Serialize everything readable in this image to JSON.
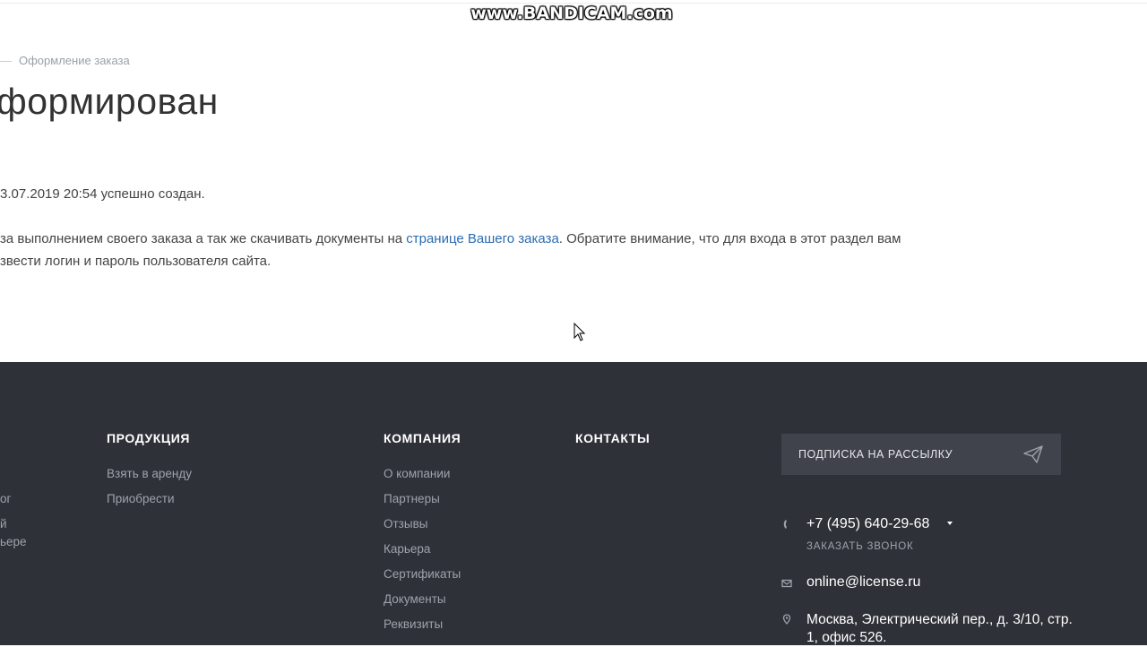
{
  "watermark": "www.BANDICAM.com",
  "breadcrumb": {
    "current": "Оформление заказа"
  },
  "page": {
    "title": "формирован",
    "line1": "3.07.2019 20:54 успешно создан.",
    "line2_before": "за выполнением своего заказа а так же скачивать документы на ",
    "line2_link": "странице Вашего заказа",
    "line2_after": ". Обратите внимание, что для входа в этот раздел вам",
    "line3": "звести логин и пароль пользователя сайта."
  },
  "footer": {
    "left_fragments": [
      "ог",
      "й",
      "ьере"
    ],
    "products": {
      "title": "ПРОДУКЦИЯ",
      "items": [
        "Взять в аренду",
        "Приобрести"
      ]
    },
    "company": {
      "title": "КОМПАНИЯ",
      "items": [
        "О компании",
        "Партнеры",
        "Отзывы",
        "Карьера",
        "Сертификаты",
        "Документы",
        "Реквизиты"
      ]
    },
    "contacts": {
      "title": "КОНТАКТЫ"
    },
    "subscribe": {
      "label": "ПОДПИСКА НА РАССЫЛКУ"
    },
    "phone": "+7 (495) 640-29-68",
    "callback": "ЗАКАЗАТЬ ЗВОНОК",
    "email": "online@license.ru",
    "address": "Москва, Электрический пер., д. 3/10, стр. 1, офис 526."
  },
  "colors": {
    "footer_bg": "#2f3138",
    "link": "#2b6cb0",
    "subscribe_bg": "#40434c"
  },
  "icons": [
    "phone-icon",
    "mail-icon",
    "location-icon",
    "send-icon",
    "cursor-icon"
  ]
}
